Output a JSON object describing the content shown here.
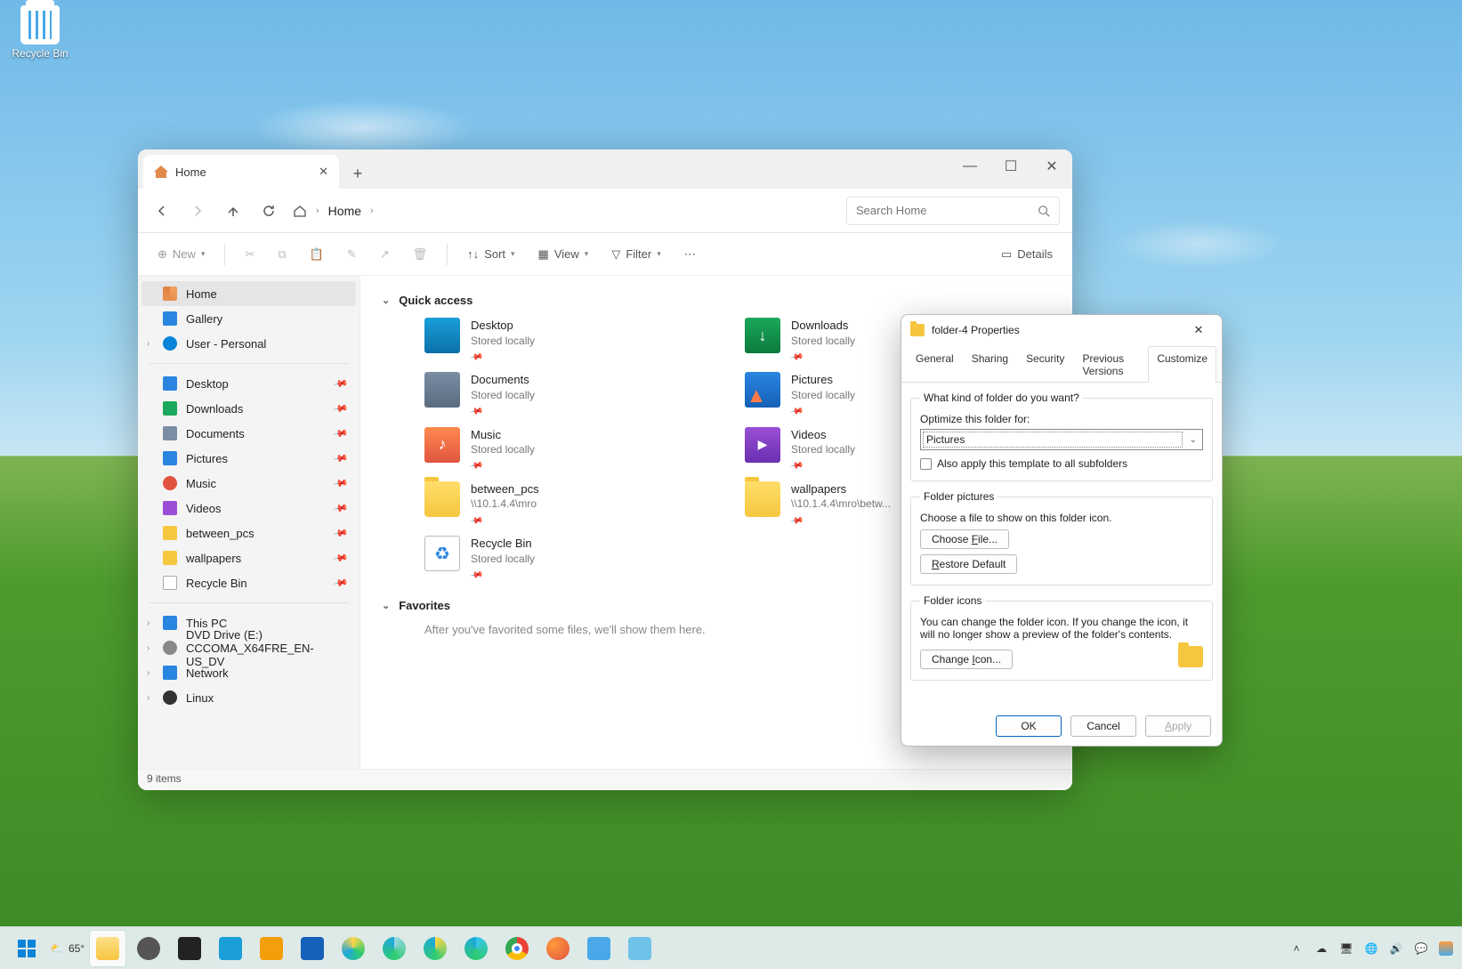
{
  "desktop": {
    "recycle_bin": "Recycle Bin"
  },
  "explorer": {
    "tab": {
      "title": "Home"
    },
    "window_controls": {
      "min": "—",
      "max": "☐",
      "close": "✕"
    },
    "nav": {
      "back": "←",
      "forward": "→",
      "up": "↑",
      "refresh": "⟳"
    },
    "breadcrumb": {
      "home_icon": "⌂",
      "location": "Home"
    },
    "search": {
      "placeholder": "Search Home"
    },
    "toolbar": {
      "new": "New",
      "sort": "Sort",
      "view": "View",
      "filter": "Filter",
      "details": "Details"
    },
    "sidebar": {
      "top": [
        {
          "icon": "si-home",
          "label": "Home",
          "selected": true
        },
        {
          "icon": "si-gallery",
          "label": "Gallery"
        },
        {
          "icon": "si-cloud",
          "label": "User - Personal",
          "expandable": true
        }
      ],
      "pinned": [
        {
          "icon": "si-monitor",
          "label": "Desktop"
        },
        {
          "icon": "si-down",
          "label": "Downloads"
        },
        {
          "icon": "si-doc",
          "label": "Documents"
        },
        {
          "icon": "si-pic",
          "label": "Pictures"
        },
        {
          "icon": "si-mus",
          "label": "Music"
        },
        {
          "icon": "si-vid",
          "label": "Videos"
        },
        {
          "icon": "si-fold",
          "label": "between_pcs"
        },
        {
          "icon": "si-fold",
          "label": "wallpapers"
        },
        {
          "icon": "si-bin",
          "label": "Recycle Bin"
        }
      ],
      "drives": [
        {
          "icon": "si-pc",
          "label": "This PC",
          "expandable": true
        },
        {
          "icon": "si-dvd",
          "label": "DVD Drive (E:) CCCOMA_X64FRE_EN-US_DV",
          "expandable": true
        },
        {
          "icon": "si-net",
          "label": "Network",
          "expandable": true
        },
        {
          "icon": "si-linux",
          "label": "Linux",
          "expandable": true
        }
      ]
    },
    "sections": {
      "quick_access": {
        "title": "Quick access",
        "items": [
          {
            "ic": "ic-desktop",
            "name": "Desktop",
            "sub": "Stored locally"
          },
          {
            "ic": "ic-downloads",
            "name": "Downloads",
            "sub": "Stored locally"
          },
          {
            "ic": "ic-documents",
            "name": "Documents",
            "sub": "Stored locally"
          },
          {
            "ic": "ic-pictures",
            "name": "Pictures",
            "sub": "Stored locally"
          },
          {
            "ic": "ic-music",
            "name": "Music",
            "sub": "Stored locally"
          },
          {
            "ic": "ic-videos",
            "name": "Videos",
            "sub": "Stored locally"
          },
          {
            "ic": "ic-folder",
            "name": "between_pcs",
            "sub": "\\\\10.1.4.4\\mro"
          },
          {
            "ic": "ic-folder",
            "name": "wallpapers",
            "sub": "\\\\10.1.4.4\\mro\\betw..."
          },
          {
            "ic": "ic-bin",
            "name": "Recycle Bin",
            "sub": "Stored locally"
          }
        ]
      },
      "favorites": {
        "title": "Favorites",
        "empty": "After you've favorited some files, we'll show them here."
      }
    },
    "status": "9 items"
  },
  "props": {
    "title": "folder-4 Properties",
    "tabs": [
      "General",
      "Sharing",
      "Security",
      "Previous Versions",
      "Customize"
    ],
    "active_tab": 4,
    "group1": {
      "legend": "What kind of folder do you want?",
      "optimize": "Optimize this folder for:",
      "value": "Pictures",
      "apply_sub": "Also apply this template to all subfolders"
    },
    "group2": {
      "legend": "Folder pictures",
      "desc": "Choose a file to show on this folder icon.",
      "choose": "Choose File...",
      "restore": "Restore Default"
    },
    "group3": {
      "legend": "Folder icons",
      "desc": "You can change the folder icon. If you change the icon, it will no longer show a preview of the folder's contents.",
      "change": "Change Icon..."
    },
    "footer": {
      "ok": "OK",
      "cancel": "Cancel",
      "apply": "Apply"
    }
  },
  "taskbar": {
    "weather": {
      "temp": "65°",
      "icon": "⛅"
    },
    "tray": {
      "time": "",
      "date": ""
    }
  }
}
